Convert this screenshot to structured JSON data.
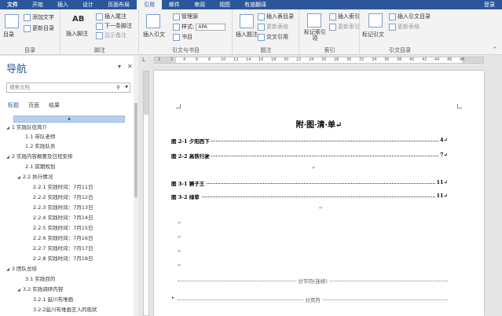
{
  "tabs": [
    "文件",
    "开始",
    "插入",
    "设计",
    "页面布局",
    "引用",
    "邮件",
    "审阅",
    "视图",
    "有道翻译"
  ],
  "active_tab": "引用",
  "login": "登录",
  "ribbon": {
    "toc_group": {
      "label": "目录",
      "toc_btn": "目录",
      "add_text": "添加文字",
      "update_toc": "更新目录"
    },
    "footnote_group": {
      "label": "脚注",
      "insert_footnote": "插入脚注",
      "ab_icon": "AB",
      "insert_endnote": "插入尾注",
      "next_footnote": "下一条脚注",
      "show_notes": "显示备注"
    },
    "citation_group": {
      "label": "引文与书目",
      "insert_citation": "插入引文",
      "manage_sources": "管理源",
      "style_label": "样式:",
      "style_value": "APA",
      "bibliography": "书目"
    },
    "caption_group": {
      "label": "题注",
      "insert_caption": "插入题注",
      "insert_table_figures": "插入表目录",
      "update_table": "更新表格",
      "cross_reference": "交叉引用"
    },
    "index_group": {
      "label": "索引",
      "mark_entry": "标记索引项",
      "insert_index": "插入索引",
      "update_index": "更新索引"
    },
    "authorities_group": {
      "label": "引文目录",
      "mark_citation": "标记引文",
      "insert_authorities": "插入引文目录",
      "update_table": "更新表格"
    }
  },
  "nav": {
    "title": "导航",
    "search_placeholder": "搜索文档",
    "tabs": [
      "标题",
      "页面",
      "结果"
    ],
    "items": [
      "1 实践队伍简介",
      "1.1 带队老师",
      "1.2 实践队员",
      "2 实践内容概要及日程安排",
      "2.1 前期规划",
      "2.2 执行情况",
      "2.2.1 实践时间：7月11日",
      "2.2.2 实践时间：7月12日",
      "2.2.3 实践时间：7月13日",
      "2.2.4 实践时间：7月14日",
      "2.2.5 实践时间：7月15日",
      "2.2.6 实践时间：7月16日",
      "2.2.7 实践时间：7月17日",
      "2.2.8 实践时间：7月18日",
      "3 团队总结",
      "3.1 实践目的",
      "3.2 实践调研内容",
      "3.2.1 延川布堆画",
      "3.2.2延川布堆画艺人的现状"
    ]
  },
  "ruler": {
    "ticks": [
      "2",
      "2",
      "4",
      "6",
      "8",
      "10",
      "12",
      "14",
      "16",
      "18",
      "20",
      "22",
      "24",
      "26",
      "28",
      "30",
      "32",
      "34",
      "36",
      "38",
      "40",
      "42",
      "44",
      "46",
      "48"
    ]
  },
  "document": {
    "title": "附·图·清·单↵",
    "entries": [
      {
        "label": "图 2-1 夕阳西下",
        "page": "4↵"
      },
      {
        "label": "图 2-2 高铁行驶",
        "page": "7↵"
      },
      {
        "label": "图 3-1 狮子王",
        "page": "11↵"
      },
      {
        "label": "图 3-2 绿草",
        "page": "11↵"
      }
    ],
    "section_break": "分节符(连续)",
    "page_break": "分页符",
    "para_mark": "↵"
  }
}
